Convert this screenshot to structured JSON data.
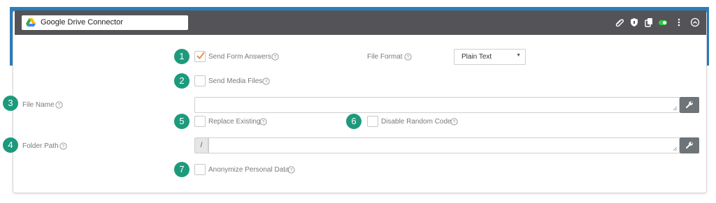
{
  "header": {
    "title": "Google Drive Connector",
    "icons": [
      "paperclip-icon",
      "shield-icon",
      "copy-icon",
      "toggle-icon",
      "more-vert-icon",
      "collapse-icon"
    ],
    "toggle_color": "#2ecc40"
  },
  "form": {
    "send_form_answers": {
      "number": "1",
      "label": "Send Form Answers",
      "checked": true
    },
    "file_format": {
      "label": "File Format",
      "value": "Plain Text"
    },
    "send_media_files": {
      "number": "2",
      "label": "Send Media Files",
      "checked": false
    },
    "file_name": {
      "number": "3",
      "label": "File Name",
      "value": ""
    },
    "replace_existing": {
      "number": "5",
      "label": "Replace Existing",
      "checked": false
    },
    "disable_random_code": {
      "number": "6",
      "label": "Disable Random Code",
      "checked": false
    },
    "folder_path": {
      "number": "4",
      "label": "Folder Path",
      "prefix": "/",
      "value": ""
    },
    "anonymize_personal_data": {
      "number": "7",
      "label": "Anonymize Personal Data",
      "checked": false
    }
  },
  "colors": {
    "header_bg": "#545458",
    "band_blue": "#2c7dbd",
    "badge_green": "#1d9a7c",
    "check_orange": "#e8833a",
    "button_gray": "#6e7478"
  }
}
